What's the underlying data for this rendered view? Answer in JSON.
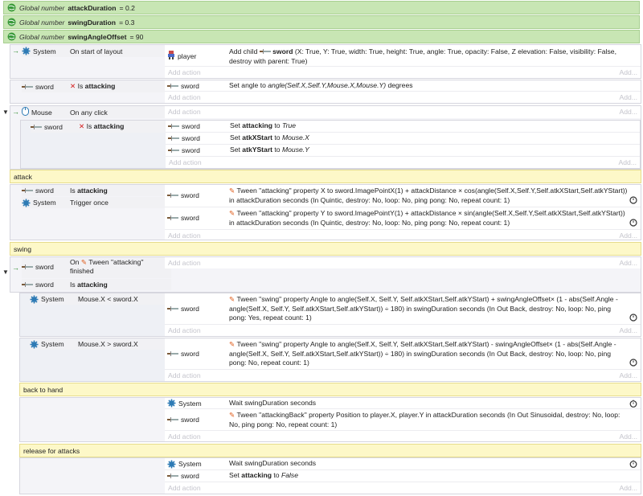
{
  "globals": [
    {
      "prefix": "Global number",
      "name": "attackDuration",
      "eq": "= 0.2"
    },
    {
      "prefix": "Global number",
      "name": "swingDuration",
      "eq": "= 0.3"
    },
    {
      "prefix": "Global number",
      "name": "swingAngleOffset",
      "eq": "= 90"
    }
  ],
  "common": {
    "add_action": "Add action",
    "add_dots": "Add...",
    "is": "Is",
    "attacking": "attacking"
  },
  "ev1": {
    "obj": "System",
    "cond": "On start of layout",
    "act_obj": "player",
    "act_html_parts": [
      "Add child",
      "sword",
      "(X: True, Y: True, width: True, height: True, angle: True, opacity: False, Z elevation: False, visibility: False, destroy with parent: True)"
    ]
  },
  "ev2": {
    "obj": "sword",
    "act_obj": "sword",
    "act_text": "Set angle to",
    "act_expr": "angle(Self.X,Self.Y,Mouse.X,Mouse.Y)",
    "act_tail": "degrees"
  },
  "ev3": {
    "obj": "Mouse",
    "cond": "On any click",
    "sub_obj": "sword",
    "acts": [
      {
        "obj": "sword",
        "lead": "Set",
        "name": "attacking",
        "to": "to",
        "val": "True"
      },
      {
        "obj": "sword",
        "lead": "Set",
        "name": "atkXStart",
        "to": "to",
        "val": "Mouse.X"
      },
      {
        "obj": "sword",
        "lead": "Set",
        "name": "atkYStart",
        "to": "to",
        "val": "Mouse.Y"
      }
    ]
  },
  "group_attack": {
    "label": "attack"
  },
  "ev4": {
    "c1_obj": "sword",
    "c2_obj": "System",
    "c2": "Trigger once",
    "a1_obj": "sword",
    "a1": "Tween \"attacking\" property X to sword.ImagePointX(1) + attackDistance × cos(angle(Self.X,Self.Y,Self.atkXStart,Self.atkYStart)) in attackDuration seconds (In Quintic, destroy: No, loop: No, ping pong: No, repeat count: 1)",
    "a2_obj": "sword",
    "a2": "Tween \"attacking\" property Y to sword.ImagePointY(1) + attackDistance × sin(angle(Self.X,Self.Y,Self.atkXStart,Self.atkYStart)) in attackDuration seconds (In Quintic, destroy: No, loop: No, ping pong: No, repeat count: 1)"
  },
  "group_swing": {
    "label": "swing"
  },
  "ev5": {
    "c1_obj": "sword",
    "c1_on": "On",
    "c1_tween": "Tween \"attacking\" finished",
    "c2_obj": "sword",
    "s1_obj": "System",
    "s1": "Mouse.X < sword.X",
    "s1_act_obj": "sword",
    "s1_act": "Tween \"swing\" property Angle to angle(Self.X, Self.Y, Self.atkXStart,Self.atkYStart) + swingAngleOffset× (1 - abs(Self.Angle - angle(Self.X, Self.Y, Self.atkXStart,Self.atkYStart)) ÷ 180) in swingDuration seconds (In Out Back, destroy: No, loop: No, ping pong: Yes, repeat count: 1)",
    "s2_obj": "System",
    "s2": "Mouse.X > sword.X",
    "s2_act_obj": "sword",
    "s2_act": "Tween \"swing\" property Angle to angle(Self.X, Self.Y, Self.atkXStart,Self.atkYStart) - swingAngleOffset× (1 - abs(Self.Angle - angle(Self.X, Self.Y, Self.atkXStart,Self.atkYStart)) ÷ 180) in swingDuration seconds (In Out Back, destroy: No, loop: No, ping pong: No, repeat count: 1)"
  },
  "group_back": {
    "label": "back to hand"
  },
  "ev6": {
    "a1_obj": "System",
    "a1": "Wait swingDuration seconds",
    "a2_obj": "sword",
    "a2": "Tween \"attackingBack\" property Position to player.X, player.Y in attackDuration seconds (In Out Sinusoidal, destroy: No, loop: No, ping pong: No, repeat count: 1)"
  },
  "group_release": {
    "label": "release for attacks"
  },
  "ev7": {
    "a1_obj": "System",
    "a1": "Wait swingDuration seconds",
    "a2_obj": "sword",
    "a2_lead": "Set",
    "a2_name": "attacking",
    "a2_to": "to",
    "a2_val": "False"
  },
  "colors": {
    "global_bg": "#c8e6b4",
    "group_bg": "#fdf8c8",
    "event_bg": "#f4f4f8",
    "x_red": "#d42020",
    "arrow_green": "#2a8a2a"
  }
}
